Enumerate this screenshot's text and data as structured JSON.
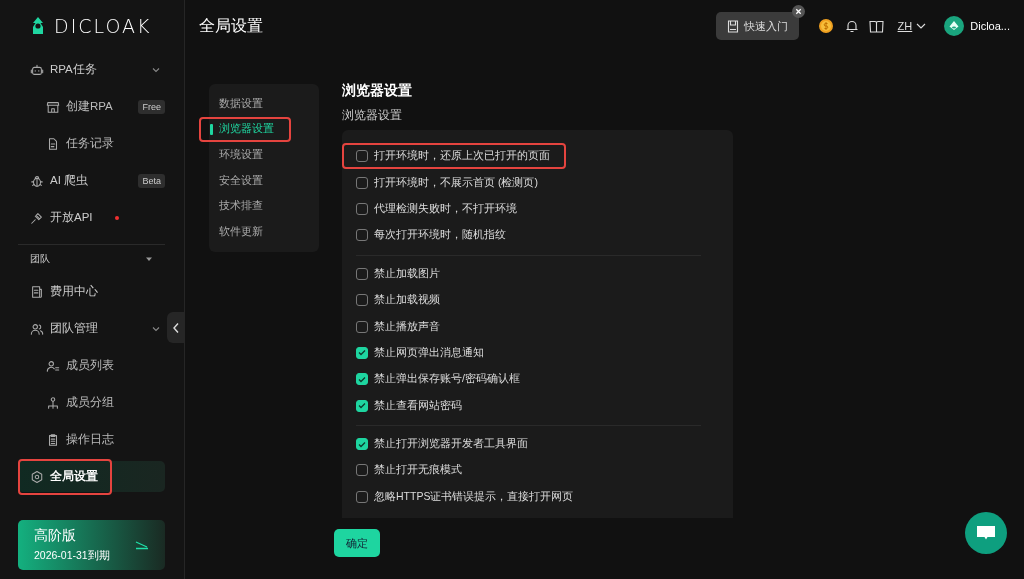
{
  "logo": {
    "text": "DICLOAK"
  },
  "sidebar": {
    "items": [
      {
        "kind": "group",
        "label": "RPA任务",
        "expanded": true,
        "selected": false,
        "highlighted": false,
        "children": [
          {
            "label": "创建RPA",
            "badge": "Free",
            "selected": false,
            "highlighted": false
          },
          {
            "label": "任务记录",
            "selected": false,
            "highlighted": false
          }
        ]
      },
      {
        "kind": "item",
        "label": "AI 爬虫",
        "badge": "Beta",
        "selected": false,
        "highlighted": false
      },
      {
        "kind": "item",
        "label": "开放API",
        "dot": true,
        "selected": false,
        "highlighted": false
      },
      {
        "kind": "section",
        "label": "团队",
        "expanded": true
      },
      {
        "kind": "item",
        "label": "费用中心",
        "selected": false,
        "highlighted": false
      },
      {
        "kind": "group",
        "label": "团队管理",
        "expanded": true,
        "selected": false,
        "highlighted": false,
        "children": [
          {
            "label": "成员列表",
            "selected": false,
            "highlighted": false
          },
          {
            "label": "成员分组",
            "selected": false,
            "highlighted": false
          },
          {
            "label": "操作日志",
            "selected": false,
            "highlighted": false
          }
        ]
      },
      {
        "kind": "item",
        "label": "全局设置",
        "selected": true,
        "highlighted": true
      }
    ]
  },
  "plan": {
    "name": "高阶版",
    "expiry": "2026-01-31到期"
  },
  "header": {
    "title": "全局设置",
    "quick_start": "快速入门",
    "language": "ZH",
    "user": "Dicloa..."
  },
  "settings_nav": {
    "items": [
      {
        "label": "数据设置",
        "selected": false,
        "highlighted": false
      },
      {
        "label": "浏览器设置",
        "selected": true,
        "highlighted": true
      },
      {
        "label": "环境设置",
        "selected": false,
        "highlighted": false
      },
      {
        "label": "安全设置",
        "selected": false,
        "highlighted": false
      },
      {
        "label": "技术排查",
        "selected": false,
        "highlighted": false
      },
      {
        "label": "软件更新",
        "selected": false,
        "highlighted": false
      }
    ]
  },
  "content": {
    "title": "浏览器设置",
    "subtitle": "浏览器设置",
    "groups": [
      {
        "options": [
          {
            "label": "打开环境时，还原上次已打开的页面",
            "checked": false,
            "highlighted": true
          },
          {
            "label": "打开环境时，不展示首页 (检测页)",
            "checked": false,
            "highlighted": false
          },
          {
            "label": "代理检测失败时，不打开环境",
            "checked": false,
            "highlighted": false
          },
          {
            "label": "每次打开环境时，随机指纹",
            "checked": false,
            "highlighted": false
          }
        ]
      },
      {
        "options": [
          {
            "label": "禁止加载图片",
            "checked": false,
            "highlighted": false
          },
          {
            "label": "禁止加载视频",
            "checked": false,
            "highlighted": false
          },
          {
            "label": "禁止播放声音",
            "checked": false,
            "highlighted": false
          },
          {
            "label": "禁止网页弹出消息通知",
            "checked": true,
            "highlighted": false
          },
          {
            "label": "禁止弹出保存账号/密码确认框",
            "checked": true,
            "highlighted": false
          },
          {
            "label": "禁止查看网站密码",
            "checked": true,
            "highlighted": false
          }
        ]
      },
      {
        "options": [
          {
            "label": "禁止打开浏览器开发者工具界面",
            "checked": true,
            "highlighted": false
          },
          {
            "label": "禁止打开无痕模式",
            "checked": false,
            "highlighted": false
          },
          {
            "label": "忽略HTTPS证书错误提示，直接打开网页",
            "checked": false,
            "highlighted": false
          }
        ]
      }
    ],
    "confirm": "确定"
  }
}
